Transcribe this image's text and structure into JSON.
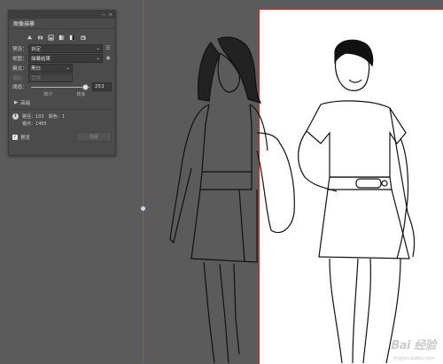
{
  "panel": {
    "tab_title": "图像描摹",
    "top_controls": [
      "‹‹",
      "≡"
    ],
    "preset": {
      "label": "预设：",
      "value": "自定"
    },
    "view": {
      "label": "视图：",
      "value": "描摹结果"
    },
    "mode": {
      "label": "模式：",
      "value": "黑白"
    },
    "palette": {
      "label": "调板：",
      "value": "受限"
    },
    "threshold": {
      "label": "阈值：",
      "value": "253",
      "fill": 0.93,
      "min_label": "较少",
      "max_label": "较多"
    },
    "advanced_label": "高级",
    "info": {
      "paths_label": "路径：",
      "paths_value": "103",
      "colors_label": "颜色：",
      "colors_value": "1",
      "anchors_label": "锚点：",
      "anchors_value": "1465"
    },
    "preview_label": "预览",
    "trace_button": "描摹"
  },
  "watermark": {
    "text": "Bai 经验",
    "sub": "jingyan.baidu.com"
  },
  "colors": {
    "panel_bg": "#4b4b4b",
    "canvas_bg": "#5b5b5b",
    "artboard_border": "#b33a3a",
    "guide": "#4d6da8"
  }
}
